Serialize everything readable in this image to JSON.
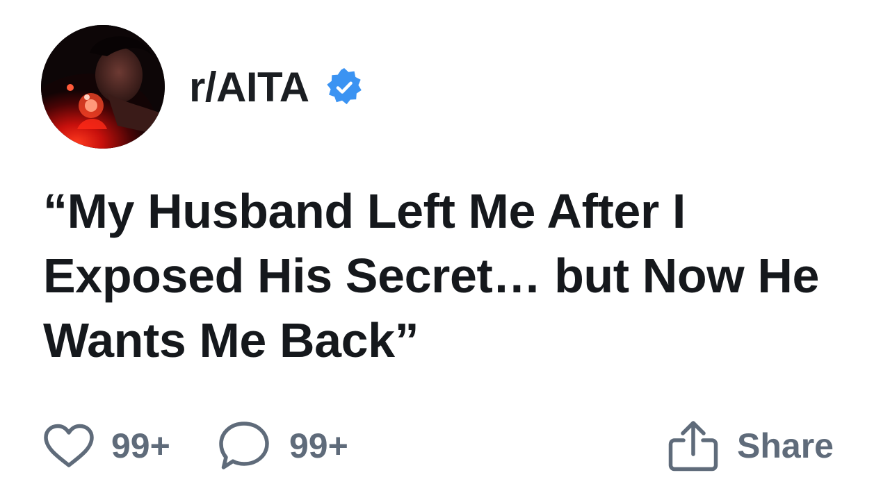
{
  "post": {
    "subreddit": "r/AITA",
    "title": "“My Husband Left Me After I Exposed His Secret… but Now He Wants Me Back”"
  },
  "actions": {
    "likes": "99+",
    "comments": "99+",
    "share_label": "Share"
  },
  "icons": {
    "avatar": "avatar-image",
    "verified": "verified-badge-icon",
    "like": "heart-icon",
    "comment": "comment-bubble-icon",
    "share": "share-icon"
  },
  "colors": {
    "background": "#ffffff",
    "text": "#15181c",
    "muted": "#5f6b7a",
    "verified": "#3b93f2",
    "avatar_glow": "#ff1a12"
  }
}
